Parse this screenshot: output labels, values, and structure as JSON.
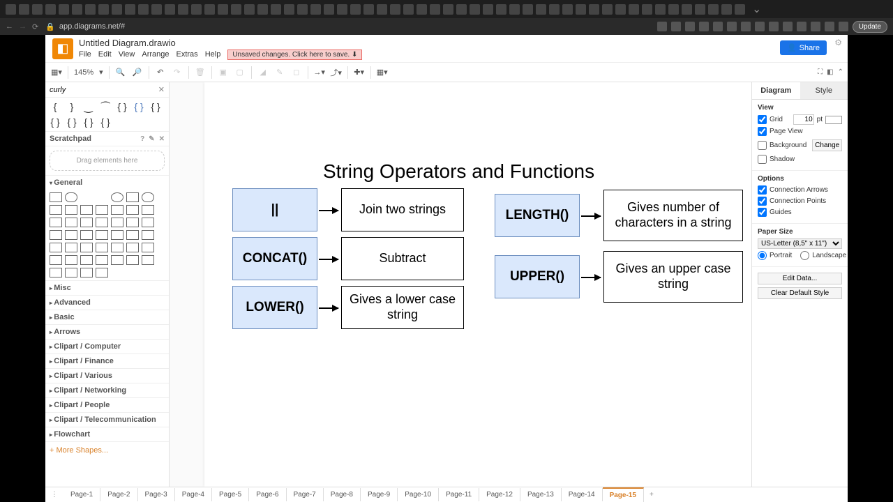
{
  "browser": {
    "url": "app.diagrams.net/#",
    "update": "Update"
  },
  "doc": {
    "title": "Untitled Diagram.drawio",
    "unsaved": "Unsaved changes. Click here to save. ⬇",
    "share": "Share"
  },
  "menu": [
    "File",
    "Edit",
    "View",
    "Arrange",
    "Extras",
    "Help"
  ],
  "toolbar": {
    "zoom": "145%"
  },
  "search": {
    "value": "curly"
  },
  "scratchpad": {
    "title": "Scratchpad",
    "hint": "Drag elements here"
  },
  "cats": [
    "General",
    "Misc",
    "Advanced",
    "Basic",
    "Arrows",
    "Clipart / Computer",
    "Clipart / Finance",
    "Clipart / Various",
    "Clipart / Networking",
    "Clipart / People",
    "Clipart / Telecommunication",
    "Flowchart"
  ],
  "moreShapes": "+ More Shapes...",
  "diagram": {
    "title": "String Operators and Functions",
    "ops": [
      {
        "op": "||",
        "desc": "Join two strings"
      },
      {
        "op": "CONCAT()",
        "desc": "Subtract"
      },
      {
        "op": "LOWER()",
        "desc": "Gives a lower case string"
      },
      {
        "op": "LENGTH()",
        "desc": "Gives number of characters in a string"
      },
      {
        "op": "UPPER()",
        "desc": "Gives an upper case string"
      }
    ]
  },
  "right": {
    "tabs": [
      "Diagram",
      "Style"
    ],
    "view": "View",
    "grid": "Grid",
    "gridVal": "10",
    "gridUnit": "pt",
    "pageView": "Page View",
    "background": "Background",
    "change": "Change",
    "shadow": "Shadow",
    "options": "Options",
    "connArrows": "Connection Arrows",
    "connPoints": "Connection Points",
    "guides": "Guides",
    "paperSize": "Paper Size",
    "paperSel": "US-Letter (8,5\" x 11\")",
    "portrait": "Portrait",
    "landscape": "Landscape",
    "editData": "Edit Data...",
    "clearStyle": "Clear Default Style"
  },
  "pages": [
    "Page-1",
    "Page-2",
    "Page-3",
    "Page-4",
    "Page-5",
    "Page-6",
    "Page-7",
    "Page-8",
    "Page-9",
    "Page-10",
    "Page-11",
    "Page-12",
    "Page-13",
    "Page-14",
    "Page-15"
  ]
}
